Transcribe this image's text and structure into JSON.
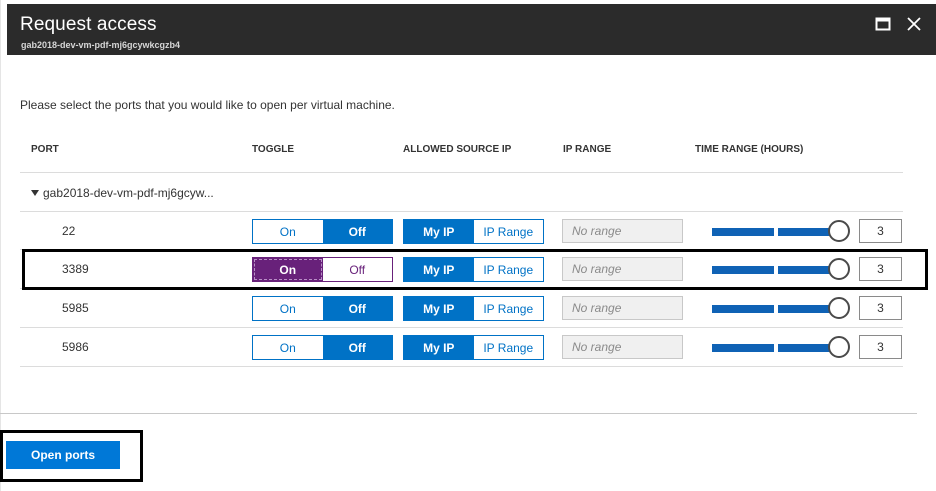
{
  "window": {
    "title": "Request access",
    "subtitle": "gab2018-dev-vm-pdf-mj6gcywkcgzb4"
  },
  "instructions": "Please select the ports that you would like to open per virtual machine.",
  "columns": {
    "port": "PORT",
    "toggle": "TOGGLE",
    "allowed_source_ip": "ALLOWED SOURCE IP",
    "ip_range": "IP RANGE",
    "time_range": "TIME RANGE (HOURS)"
  },
  "vm_group": "gab2018-dev-vm-pdf-mj6gcyw...",
  "rows": [
    {
      "port": "22",
      "on_label": "On",
      "off_label": "Off",
      "toggle_state": "Off",
      "myip_label": "My IP",
      "range_label": "IP Range",
      "source": "My IP",
      "ip_range_placeholder": "No range",
      "hours": "3"
    },
    {
      "port": "3389",
      "on_label": "On",
      "off_label": "Off",
      "toggle_state": "On",
      "myip_label": "My IP",
      "range_label": "IP Range",
      "source": "My IP",
      "ip_range_placeholder": "No range",
      "hours": "3"
    },
    {
      "port": "5985",
      "on_label": "On",
      "off_label": "Off",
      "toggle_state": "Off",
      "myip_label": "My IP",
      "range_label": "IP Range",
      "source": "My IP",
      "ip_range_placeholder": "No range",
      "hours": "3"
    },
    {
      "port": "5986",
      "on_label": "On",
      "off_label": "Off",
      "toggle_state": "Off",
      "myip_label": "My IP",
      "range_label": "IP Range",
      "source": "My IP",
      "ip_range_placeholder": "No range",
      "hours": "3"
    }
  ],
  "footer": {
    "open_ports_label": "Open ports"
  },
  "colors": {
    "accent": "#0072c6",
    "toggle_on_selected": "#68217a",
    "title_bar": "#2b2b2b"
  },
  "icons": {
    "maximize": "maximize-icon",
    "close": "close-icon",
    "expand": "caret-down-icon"
  }
}
